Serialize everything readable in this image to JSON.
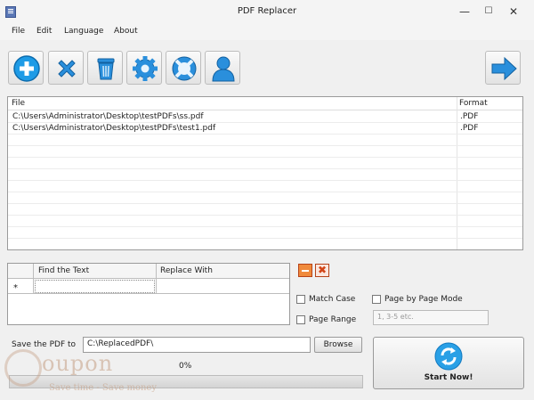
{
  "window": {
    "title": "PDF Replacer",
    "min_glyph": "—",
    "max_glyph": "☐",
    "close_glyph": "✕"
  },
  "menu": {
    "items": [
      "File",
      "Edit",
      "Language",
      "About"
    ]
  },
  "toolbar": {
    "buttons": [
      {
        "icon": "add-icon",
        "color": "#1e9be6"
      },
      {
        "icon": "remove-icon",
        "color": "#2a8fdc"
      },
      {
        "icon": "trash-icon",
        "color": "#2a8fdc"
      },
      {
        "icon": "gear-icon",
        "color": "#2a8fdc"
      },
      {
        "icon": "lifebuoy-icon",
        "color": "#2a8fdc"
      },
      {
        "icon": "user-icon",
        "color": "#2a8fdc"
      }
    ],
    "next_icon": "arrow-right-icon"
  },
  "file_list": {
    "columns": [
      "File",
      "Format"
    ],
    "rows": [
      {
        "path": "C:\\Users\\Administrator\\Desktop\\testPDFs\\ss.pdf",
        "format": ".PDF"
      },
      {
        "path": "C:\\Users\\Administrator\\Desktop\\testPDFs\\test1.pdf",
        "format": ".PDF"
      }
    ]
  },
  "replace_grid": {
    "columns": [
      "Find the Text",
      "Replace With"
    ],
    "new_row_marker": "*"
  },
  "options": {
    "match_case": {
      "label": "Match Case",
      "checked": false
    },
    "page_range": {
      "label": "Page Range",
      "checked": false,
      "placeholder": "1, 3-5 etc."
    },
    "page_by_page": {
      "label": "Page by Page Mode",
      "checked": false
    }
  },
  "output": {
    "save_label": "Save the PDF to",
    "path": "C:\\ReplacedPDF\\",
    "browse_label": "Browse",
    "progress_text": "0%",
    "progress_value": 0
  },
  "start": {
    "label": "Start Now!"
  },
  "watermark": {
    "text": "oupon",
    "tagline": "Save time - Save money"
  }
}
